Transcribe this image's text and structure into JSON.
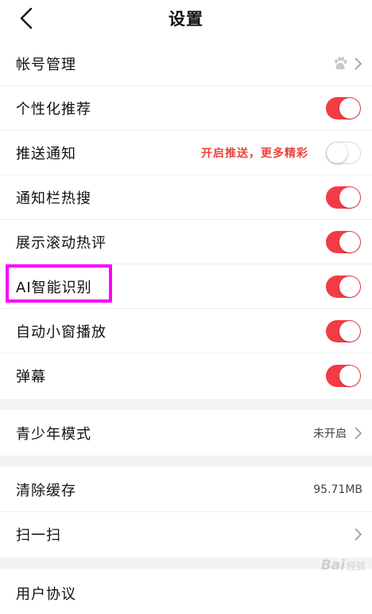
{
  "header": {
    "title": "设置"
  },
  "rows": [
    {
      "label": "帐号管理"
    },
    {
      "label": "个性化推荐",
      "on": true
    },
    {
      "label": "推送通知",
      "on": false,
      "promo": "开启推送，更多精彩"
    },
    {
      "label": "通知栏热搜",
      "on": true
    },
    {
      "label": "展示滚动热评",
      "on": true
    },
    {
      "label": "AI智能识别",
      "on": true
    },
    {
      "label": "自动小窗播放",
      "on": true
    },
    {
      "label": "弹幕",
      "on": true
    }
  ],
  "teen_mode": {
    "label": "青少年模式",
    "value": "未开启"
  },
  "cache": {
    "label": "清除缓存",
    "value": "95.71MB"
  },
  "scan": {
    "label": "扫一扫"
  },
  "agreement": {
    "label": "用户协议"
  },
  "watermark": {
    "text": "Bai",
    "sub": "经验"
  },
  "colors": {
    "accent": "#f23b45",
    "highlight": "#ff00ff",
    "promo": "#e8453c"
  }
}
